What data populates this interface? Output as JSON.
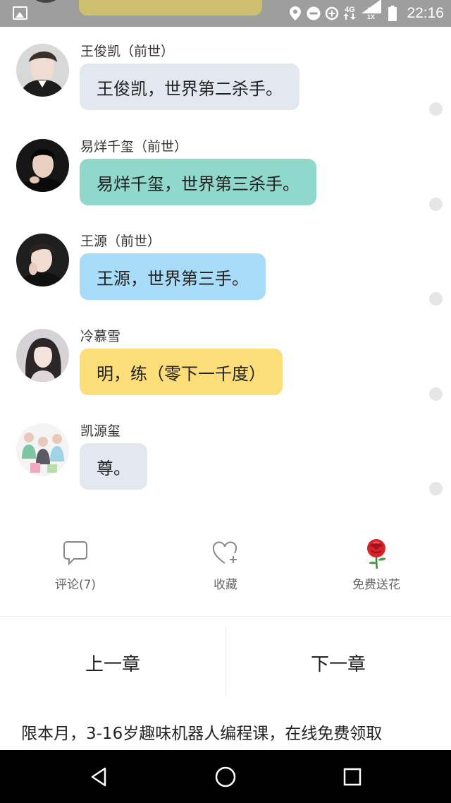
{
  "status_bar": {
    "time": "22:16",
    "network_1": "4G",
    "network_2_top": "4G",
    "network_2_bottom": "1X",
    "icons": [
      "gallery-icon",
      "location-icon",
      "do-not-disturb-icon",
      "data-saver-icon",
      "signal-icon",
      "battery-icon"
    ]
  },
  "messages": [
    {
      "name": "王俊凯（前世）",
      "text": "王俊凯，世界第二杀手。",
      "bubble_color": "#e3e8f0"
    },
    {
      "name": "易烊千玺（前世）",
      "text": "易烊千玺，世界第三杀手。",
      "bubble_color": "#8fd8cb"
    },
    {
      "name": "王源（前世）",
      "text": "王源，世界第三手。",
      "bubble_color": "#a8dcf8"
    },
    {
      "name": "冷慕雪",
      "text": "明，练（零下一千度）",
      "bubble_color": "#fbde7a"
    },
    {
      "name": "凯源玺",
      "text": "尊。",
      "bubble_color": "#e3e8f0"
    }
  ],
  "actions": {
    "comment_label": "评论(7)",
    "favorite_label": "收藏",
    "flower_label": "免费送花"
  },
  "chapters": {
    "prev_label": "上一章",
    "next_label": "下一章"
  },
  "ad_text": "限本月，3-16岁趣味机器人编程课，在线免费领取",
  "nav": {
    "icons": [
      "back-icon",
      "home-icon",
      "recents-icon"
    ]
  }
}
